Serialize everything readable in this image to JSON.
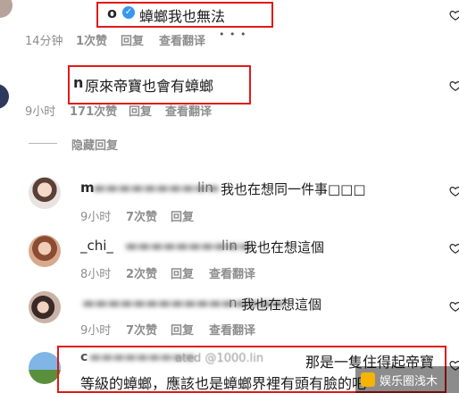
{
  "comments": [
    {
      "username": "o",
      "text": "蟑螂我也無法",
      "time": "14分钟",
      "likes": "1次赞",
      "reply": "回复",
      "translate": "查看翻译",
      "more": "• • •"
    },
    {
      "username": "n",
      "text": "原來帝寶也會有蟑螂",
      "time": "9小时",
      "likes": "171次赞",
      "reply": "回复",
      "translate": "查看翻译"
    }
  ],
  "hide_replies": "隐藏回复",
  "replies": [
    {
      "username": "m",
      "mention": "lin",
      "text": "我也在想同一件事□□□",
      "time": "9小时",
      "likes": "7次赞",
      "reply": "回复"
    },
    {
      "username": "_chi_",
      "mention": "lin",
      "text": "我也在想這個",
      "time": "8小时",
      "likes": "2次赞",
      "reply": "回复",
      "translate": "查看翻译"
    },
    {
      "username": "",
      "mention": "n",
      "text": "我也在想這個",
      "time": "9小时",
      "likes": "7次赞",
      "reply": "回复",
      "translate": "查看翻译"
    },
    {
      "username": "c",
      "mention": "ated @1000.lin",
      "text_line1": "那是一隻住得起帝寶",
      "text_line2": "等級的蟑螂，應該也是蟑螂界裡有頭有臉的吧"
    }
  ],
  "watermark": "娱乐圈浅木"
}
